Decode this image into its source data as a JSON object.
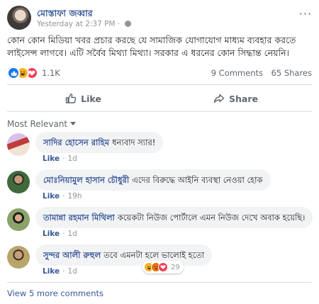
{
  "post": {
    "author": "মোস্তাফা জব্বার",
    "timestamp": "Yesterday at 2:37 PM",
    "timestamp_separator": "·",
    "more_label": "···",
    "text": "কোন কোন মিডিয়া খবর প্রচার করছে যে সামাজিক যোগাযোগ মাধ্যম ব্যবহার করতে লাইসেন্স লাগবে। এটি সর্বৈব মিথ্যা মিথ্যা। সরকার এ ধরনের কোন সিদ্ধান্ত নেয়নি।",
    "reactions": {
      "icons": [
        "like-icon",
        "haha-icon",
        "love-icon"
      ],
      "count": "1.1K"
    },
    "comments_count": "9 Comments",
    "shares_count": "65 Shares",
    "actions": {
      "like_label": "Like",
      "share_label": "Share"
    }
  },
  "comments_section": {
    "sort_label": "Most Relevant",
    "comments": [
      {
        "author": "সাদির হোসেন রাহিম",
        "text": "ধন্যবাদ স্যার!",
        "like_label": "Like",
        "time": "1d"
      },
      {
        "author": "মোঃনিয়ামুল হাসান চৌধুরী",
        "text": "এদের বিরুদ্ধে আইনি ব্যবস্থা নেওয়া হোক",
        "like_label": "Like",
        "time": "19h"
      },
      {
        "author": "তামান্না রহমান মিথিলা",
        "text": "কয়েকটা নিউজ পোর্টালে এমন নিউজ দেখে অবাক হয়েছি।",
        "like_label": "Like",
        "time": "1d"
      },
      {
        "author": "সুন্দর আলী রুহুল",
        "text": "তবে এমনটা হলে ভালোই হতো",
        "like_label": "Like",
        "time": "1d",
        "reactions": {
          "icons": [
            "haha-icon",
            "angry-icon",
            "love-icon"
          ],
          "count": "29"
        }
      }
    ],
    "view_more_label": "View 5 more comments"
  },
  "colors": {
    "link_blue": "#385898",
    "like_blue": "#1877f2",
    "haha_yellow": "#f7b125",
    "love_red": "#f33e58",
    "angry_orange": "#e9710f",
    "muted_gray": "#90949c",
    "bubble_bg": "#f2f3f5"
  }
}
